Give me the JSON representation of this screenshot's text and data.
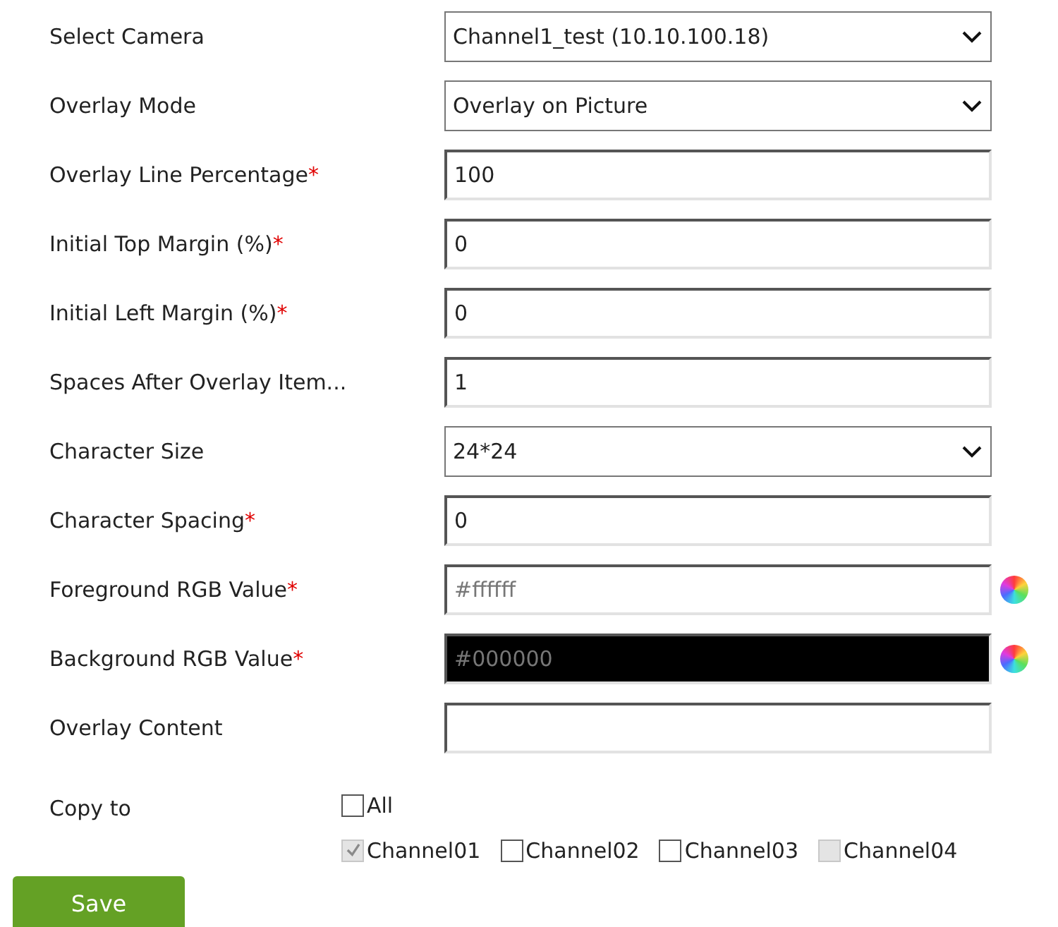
{
  "fields": [
    {
      "kind": "select",
      "label": "Select Camera",
      "value": "Channel1_test (10.10.100.18)"
    },
    {
      "kind": "select",
      "label": "Overlay Mode",
      "value": "Overlay on Picture"
    },
    {
      "kind": "input",
      "label": "Overlay Line Percentage",
      "required_mark": "*",
      "value": "100"
    },
    {
      "kind": "input",
      "label": "Initial Top Margin (%)",
      "required_mark": "*",
      "value": "0"
    },
    {
      "kind": "input",
      "label": "Initial Left Margin (%)",
      "required_mark": "*",
      "value": "0"
    },
    {
      "kind": "input",
      "label": "Spaces After Overlay Item...",
      "value": "1"
    },
    {
      "kind": "select",
      "label": "Character Size",
      "value": "24*24"
    },
    {
      "kind": "input",
      "label": "Character Spacing",
      "required_mark": "*",
      "value": "0"
    },
    {
      "kind": "color",
      "label": "Foreground RGB Value",
      "required_mark": "*",
      "value": "#ffffff",
      "color": "#ffffff"
    },
    {
      "kind": "color",
      "label": "Background RGB Value",
      "required_mark": "*",
      "value": "#000000",
      "color": "#000000"
    },
    {
      "kind": "input",
      "label": "Overlay Content"
    }
  ],
  "copy_to": {
    "label": "Copy to",
    "all": {
      "label": "All",
      "checked": false,
      "disabled": false
    },
    "channels": [
      {
        "label": "Channel01",
        "checked": true,
        "disabled": true
      },
      {
        "label": "Channel02",
        "checked": false,
        "disabled": false
      },
      {
        "label": "Channel03",
        "checked": false,
        "disabled": false
      },
      {
        "label": "Channel04",
        "checked": false,
        "disabled": true
      }
    ]
  },
  "save_button": "Save"
}
